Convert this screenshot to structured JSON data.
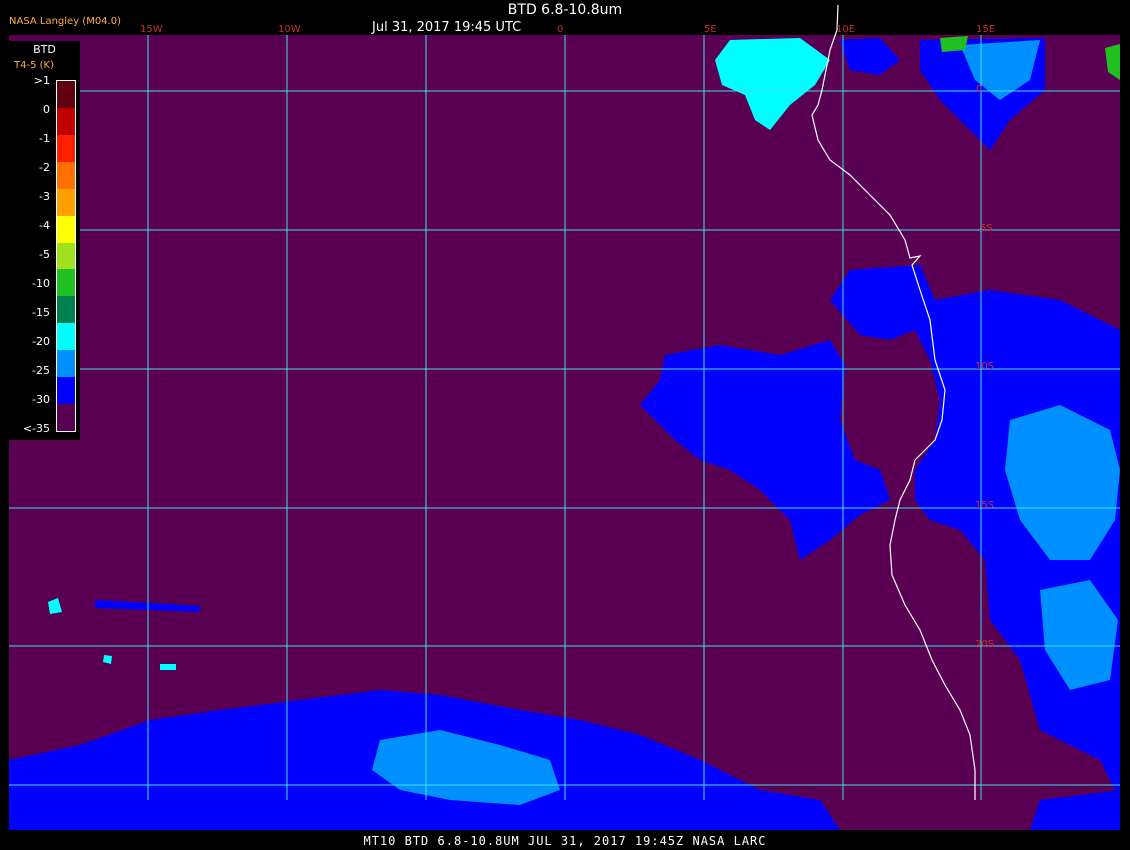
{
  "header": {
    "source": "NASA Langley (M04.0)",
    "title": "BTD 6.8-10.8um",
    "subtitle": "Jul 31, 2017 19:45 UTC"
  },
  "footer": {
    "text": "MT10  BTD 6.8-10.8UM  JUL 31, 2017 19:45Z  NASA LARC"
  },
  "map": {
    "background_color": "#5a0052",
    "grid_color": "#40e0f0",
    "coast_color": "#ffffff",
    "label_color": "#c03030",
    "lon_labels": [
      "15W",
      "10W",
      "0",
      "5E",
      "10E",
      "15E"
    ],
    "lat_labels": [
      "0",
      "5S",
      "10S",
      "15S",
      "20S"
    ]
  },
  "legend": {
    "title": "BTD",
    "unit_label": "T4-5 (K)",
    "labels": [
      ">1",
      "0",
      "-1",
      "-2",
      "-3",
      "-4",
      "-5",
      "-10",
      "-15",
      "-20",
      "-25",
      "-30",
      "<-35"
    ],
    "colors": [
      "#600010",
      "#c00000",
      "#ff2000",
      "#ff7000",
      "#ffa000",
      "#ffff00",
      "#a0e020",
      "#20c020",
      "#008050",
      "#00ffff",
      "#0090ff",
      "#0000ff",
      "#5a0052"
    ]
  }
}
